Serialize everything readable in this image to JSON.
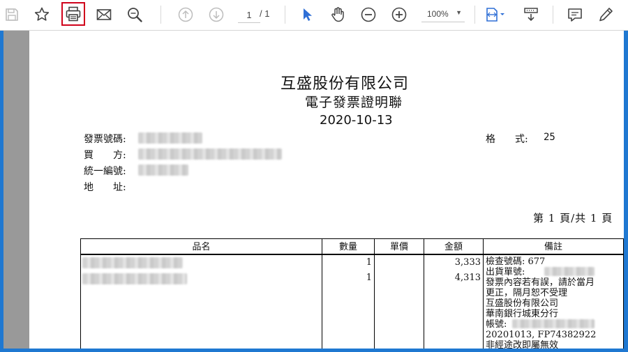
{
  "toolbar": {
    "page_current": "1",
    "page_total": "/ 1",
    "zoom": "100%"
  },
  "invoice": {
    "company": "互盛股份有限公司",
    "doc_title": "電子發票證明聯",
    "date": "2020-10-13",
    "invoice_no_label": "發票號碼:",
    "buyer_label": "買　　方:",
    "tax_id_label": "統一編號:",
    "address_label": "地　　址:",
    "format_label": "格　　式:",
    "format_value": "25",
    "page_info": "第 1 頁/共 1 頁",
    "columns": [
      "品名",
      "數量",
      "單價",
      "金額",
      "備註"
    ],
    "rows": [
      {
        "qty": "1",
        "unit": "",
        "amount": "3,333"
      },
      {
        "qty": "1",
        "unit": "",
        "amount": "4,313"
      }
    ],
    "notes": [
      "檢查號碼: 677",
      "出貨單號:",
      "發票內容若有誤，請於當月",
      "更正，隔月恕不受理",
      "互盛股份有限公司",
      "華南銀行城東分行",
      "帳號:",
      "20201013, FP74382922",
      "非經途改即屬無效"
    ]
  }
}
